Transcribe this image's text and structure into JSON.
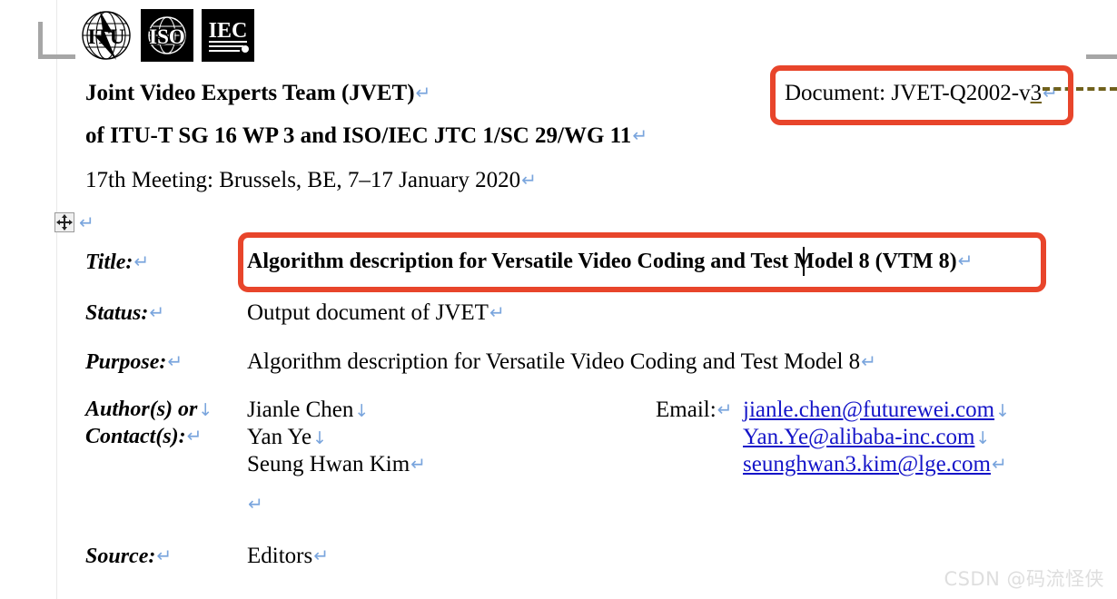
{
  "page": {
    "watermark": "CSDN @码流怪侠",
    "accent_red": "#e8452b",
    "link_blue": "#1414c8",
    "mark_blue": "#7aa5dd",
    "dash_color": "#70611c"
  },
  "logos": [
    {
      "name": "itu-logo",
      "text": "ITU"
    },
    {
      "name": "iso-logo",
      "text": "ISO"
    },
    {
      "name": "iec-logo",
      "text": "IEC"
    }
  ],
  "header": {
    "line1": "Joint Video Experts Team (JVET)",
    "line2": "of ITU-T SG 16 WP 3 and ISO/IEC JTC 1/SC 29/WG 11",
    "line3": "17th Meeting: Brussels, BE, 7–17 January 2020",
    "document_prefix": "Document: JVET-Q2002-v",
    "document_version": "3"
  },
  "fields": {
    "title": {
      "label": "Title:",
      "value_part1": "Algorithm description for Versatile Video Coding and ",
      "value_part2": "Test Model 8 (VTM 8)"
    },
    "status": {
      "label": "Status:",
      "value": "Output document of JVET"
    },
    "purpose": {
      "label": "Purpose:",
      "value": "Algorithm description for Versatile Video Coding and Test Model 8"
    },
    "authors": {
      "label_line1": "Author(s) or",
      "label_line2": "Contact(s):",
      "names": [
        "Jianle Chen",
        "Yan Ye",
        "Seung Hwan Kim"
      ],
      "email_label": "Email:",
      "emails": [
        "jianle.chen@futurewei.com",
        "Yan.Ye@alibaba-inc.com",
        "seunghwan3.kim@lge.com"
      ]
    },
    "source": {
      "label": "Source:",
      "value": "Editors"
    }
  },
  "marks": {
    "pilcrow": "↵",
    "linebreak": "↓"
  }
}
